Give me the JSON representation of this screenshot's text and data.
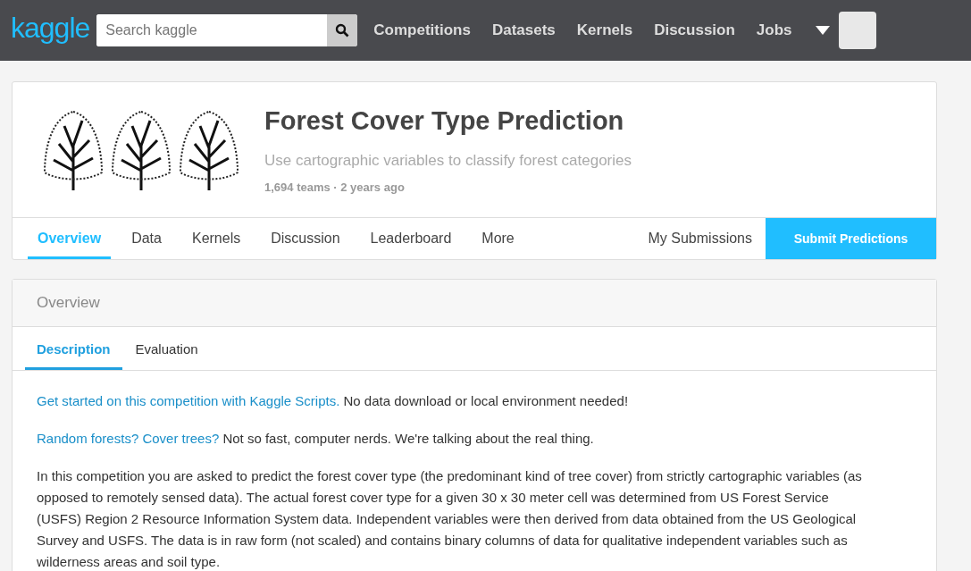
{
  "header": {
    "logo": "kaggle",
    "search": {
      "placeholder": "Search kaggle"
    },
    "nav": [
      {
        "label": "Competitions"
      },
      {
        "label": "Datasets"
      },
      {
        "label": "Kernels"
      },
      {
        "label": "Discussion"
      },
      {
        "label": "Jobs"
      }
    ]
  },
  "competition": {
    "title": "Forest Cover Type Prediction",
    "subtitle": "Use cartographic variables to classify forest categories",
    "meta": "1,694 teams · 2 years ago",
    "tabs": [
      {
        "label": "Overview",
        "selected": true
      },
      {
        "label": "Data",
        "selected": false
      },
      {
        "label": "Kernels",
        "selected": false
      },
      {
        "label": "Discussion",
        "selected": false
      },
      {
        "label": "Leaderboard",
        "selected": false
      },
      {
        "label": "More",
        "selected": false
      }
    ],
    "my_submissions": "My Submissions",
    "submit_button": "Submit Predictions"
  },
  "overview": {
    "heading": "Overview",
    "tabs": [
      {
        "label": "Description",
        "selected": true
      },
      {
        "label": "Evaluation",
        "selected": false
      }
    ],
    "paragraphs": [
      {
        "link": "Get started on this competition with Kaggle Scripts.",
        "text": " No data download or local environment needed!"
      },
      {
        "link": "Random forests? Cover trees?",
        "text": " Not so fast, computer nerds. We're talking about the real thing."
      },
      {
        "text": "In this competition you are asked to predict the forest cover type (the predominant kind of tree cover) from strictly cartographic variables (as opposed to remotely sensed data). The actual forest cover type for a given 30 x 30 meter cell was determined from US Forest Service (USFS) Region 2 Resource Information System data. Independent variables were then derived from data obtained from the US Geological Survey and USFS. The data is in raw form (not scaled) and contains binary columns of data for qualitative independent variables such as wilderness areas and soil type."
      }
    ]
  }
}
